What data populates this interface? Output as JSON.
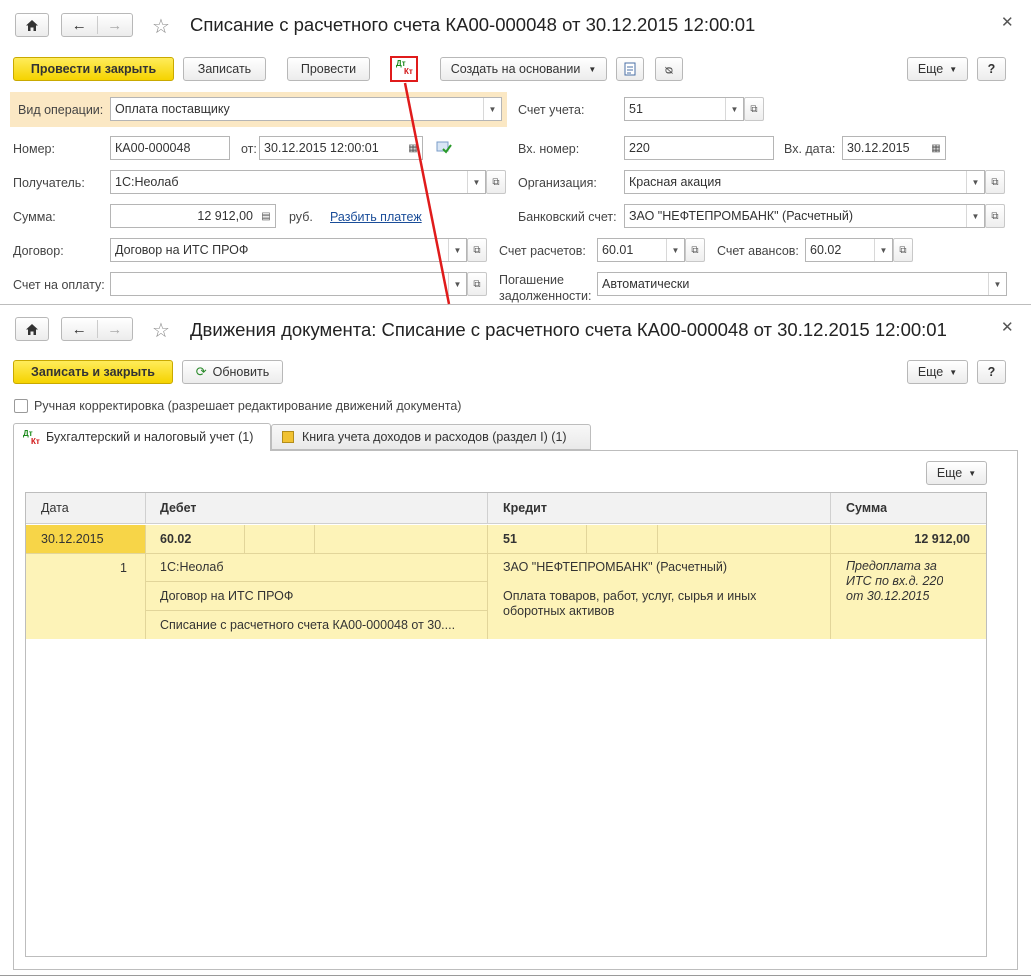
{
  "doc": {
    "title": "Списание с расчетного счета КА00-000048 от 30.12.2015 12:00:01",
    "toolbar": {
      "post_close": "Провести и закрыть",
      "save": "Записать",
      "post": "Провести",
      "dtkt_top": "Дт",
      "dtkt_bottom": "Кт",
      "create_based": "Создать на основании",
      "more": "Еще",
      "help": "?"
    },
    "form": {
      "operation_label": "Вид операции:",
      "operation_value": "Оплата поставщику",
      "account_label": "Счет учета:",
      "account_value": "51",
      "number_label": "Номер:",
      "number_value": "КА00-000048",
      "from_label": "от:",
      "from_value": "30.12.2015 12:00:01",
      "in_number_label": "Вх. номер:",
      "in_number_value": "220",
      "in_date_label": "Вх. дата:",
      "in_date_value": "30.12.2015",
      "recipient_label": "Получатель:",
      "recipient_value": "1С:Неолаб",
      "org_label": "Организация:",
      "org_value": "Красная акация",
      "sum_label": "Сумма:",
      "sum_value": "12 912,00",
      "currency": "руб.",
      "split_link": "Разбить платеж",
      "bank_label": "Банковский счет:",
      "bank_value": "ЗАО \"НЕФТЕПРОМБАНК\" (Расчетный)",
      "contract_label": "Договор:",
      "contract_value": "Договор на ИТС ПРОФ",
      "settle_label": "Счет расчетов:",
      "settle_value": "60.01",
      "advance_label": "Счет авансов:",
      "advance_value": "60.02",
      "invoice_label": "Счет на оплату:",
      "invoice_value": "",
      "repay_label_1": "Погашение",
      "repay_label_2": "задолженности:",
      "repay_value": "Автоматически"
    }
  },
  "movements": {
    "title": "Движения документа: Списание с расчетного счета КА00-000048 от 30.12.2015 12:00:01",
    "save_close": "Записать и закрыть",
    "refresh": "Обновить",
    "more": "Еще",
    "help": "?",
    "manual_label": "Ручная корректировка (разрешает редактирование движений документа)",
    "tabs": [
      {
        "label": "Бухгалтерский и налоговый учет (1)"
      },
      {
        "label": "Книга учета доходов и расходов (раздел I) (1)"
      }
    ],
    "table_more": "Еще",
    "columns": {
      "date": "Дата",
      "debit": "Дебет",
      "credit": "Кредит",
      "sum": "Сумма"
    },
    "row": {
      "date": "30.12.2015",
      "index": "1",
      "debit_account": "60.02",
      "debit_sub1": "1С:Неолаб",
      "debit_sub2": "Договор на ИТС ПРОФ",
      "debit_sub3": "Списание с расчетного счета КА00-000048 от 30....",
      "credit_account": "51",
      "credit_sub1": "ЗАО \"НЕФТЕПРОМБАНК\" (Расчетный)",
      "credit_sub2_l1": "Оплата товаров, работ, услуг, сырья и иных",
      "credit_sub2_l2": "оборотных активов",
      "sum": "12 912,00",
      "note_l1": "Предоплата за",
      "note_l2": "ИТС по вх.д. 220",
      "note_l3": "от 30.12.2015"
    }
  },
  "colors": {
    "yellow_button": "#f5d300",
    "selected_row": "#fdf0a6",
    "row_bg": "#fdf3b8",
    "annotation_red": "#e01b1b",
    "operation_highlight": "#fbe8c4"
  }
}
